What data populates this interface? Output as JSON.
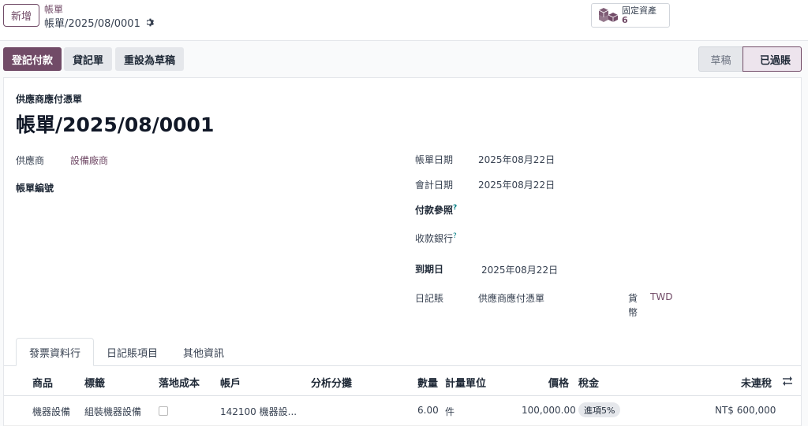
{
  "topbar": {
    "new_button": "新增",
    "breadcrumb_parent": "帳單",
    "breadcrumb_current": "帳單/2025/08/0001",
    "smart_button": {
      "label": "固定資產",
      "count": "6"
    }
  },
  "actions": {
    "register_payment": "登記付款",
    "credit_note": "貸記單",
    "reset_to_draft": "重設為草稿"
  },
  "status": {
    "draft": "草稿",
    "posted": "已過賬",
    "current": "posted"
  },
  "document": {
    "type_label": "供應商應付憑單",
    "title": "帳單/2025/08/0001"
  },
  "fields": {
    "vendor_label": "供應商",
    "vendor_value": "設備廠商",
    "bill_ref_label": "帳單編號",
    "bill_date_label": "帳單日期",
    "bill_date_value": "2025年08月22日",
    "accounting_date_label": "會計日期",
    "accounting_date_value": "2025年08月22日",
    "payment_ref_label": "付款參照",
    "recipient_bank_label": "收款銀行",
    "due_date_label": "到期日",
    "due_date_value": "2025年08月22日",
    "journal_label": "日記賬",
    "journal_value": "供應商應付憑單",
    "currency_label": "貨幣",
    "currency_value": "TWD",
    "help_mark": "?"
  },
  "tabs": [
    "發票資料行",
    "日記賬項目",
    "其他資訊"
  ],
  "table": {
    "headers": {
      "product": "商品",
      "label": "標籤",
      "landed_cost": "落地成本",
      "account": "帳戶",
      "analytic": "分析分攤",
      "quantity": "數量",
      "uom": "計量單位",
      "price": "價格",
      "tax": "稅金",
      "subtotal": "未連稅"
    },
    "rows": [
      {
        "product": "機器設備",
        "label": "組裝機器設備",
        "landed_cost": false,
        "account": "142100 機器設...",
        "analytic": "",
        "quantity": "6.00",
        "uom": "件",
        "price": "100,000.00",
        "tax": "進項5%",
        "subtotal": "NT$ 600,000"
      }
    ]
  },
  "colors": {
    "brand": "#714b67",
    "help": "#017e84"
  }
}
